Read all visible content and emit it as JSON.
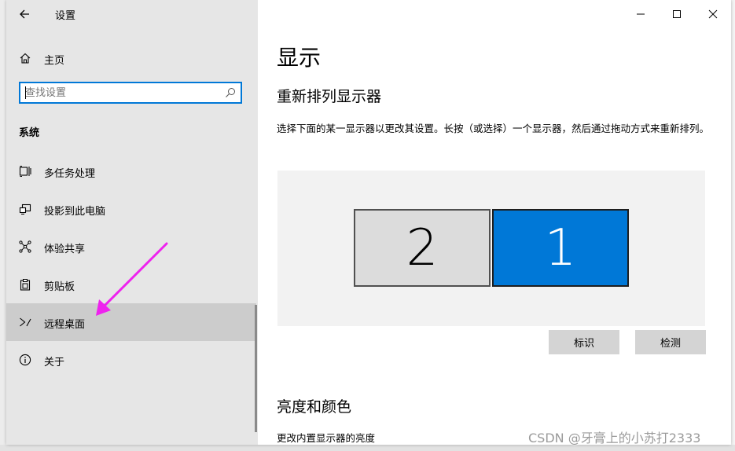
{
  "window": {
    "title": "设置"
  },
  "sidebar": {
    "home_label": "主页",
    "search_placeholder": "查找设置",
    "section_title": "系统",
    "items": [
      {
        "label": "多任务处理",
        "icon": "multitasking-icon",
        "selected": false
      },
      {
        "label": "投影到此电脑",
        "icon": "project-icon",
        "selected": false
      },
      {
        "label": "体验共享",
        "icon": "shared-experiences-icon",
        "selected": false
      },
      {
        "label": "剪贴板",
        "icon": "clipboard-icon",
        "selected": false
      },
      {
        "label": "远程桌面",
        "icon": "remote-desktop-icon",
        "selected": true
      },
      {
        "label": "关于",
        "icon": "info-icon",
        "selected": false
      }
    ]
  },
  "content": {
    "title": "显示",
    "section_rearrange": "重新排列显示器",
    "description": "选择下面的某一显示器以更改其设置。长按（或选择）一个显示器，然后通过拖动方式来重新排列。",
    "monitors": [
      {
        "number": "2",
        "selected": false
      },
      {
        "number": "1",
        "selected": true
      }
    ],
    "identify_button": "标识",
    "detect_button": "检测",
    "section_brightness": "亮度和颜色",
    "brightness_label": "更改内置显示器的亮度"
  },
  "watermark": "CSDN @牙膏上的小苏打2333",
  "colors": {
    "accent": "#0078d7",
    "sidebar_bg": "#e6e6e6",
    "selected_bg": "#cccccc",
    "annotation_arrow": "#ee22ee"
  }
}
